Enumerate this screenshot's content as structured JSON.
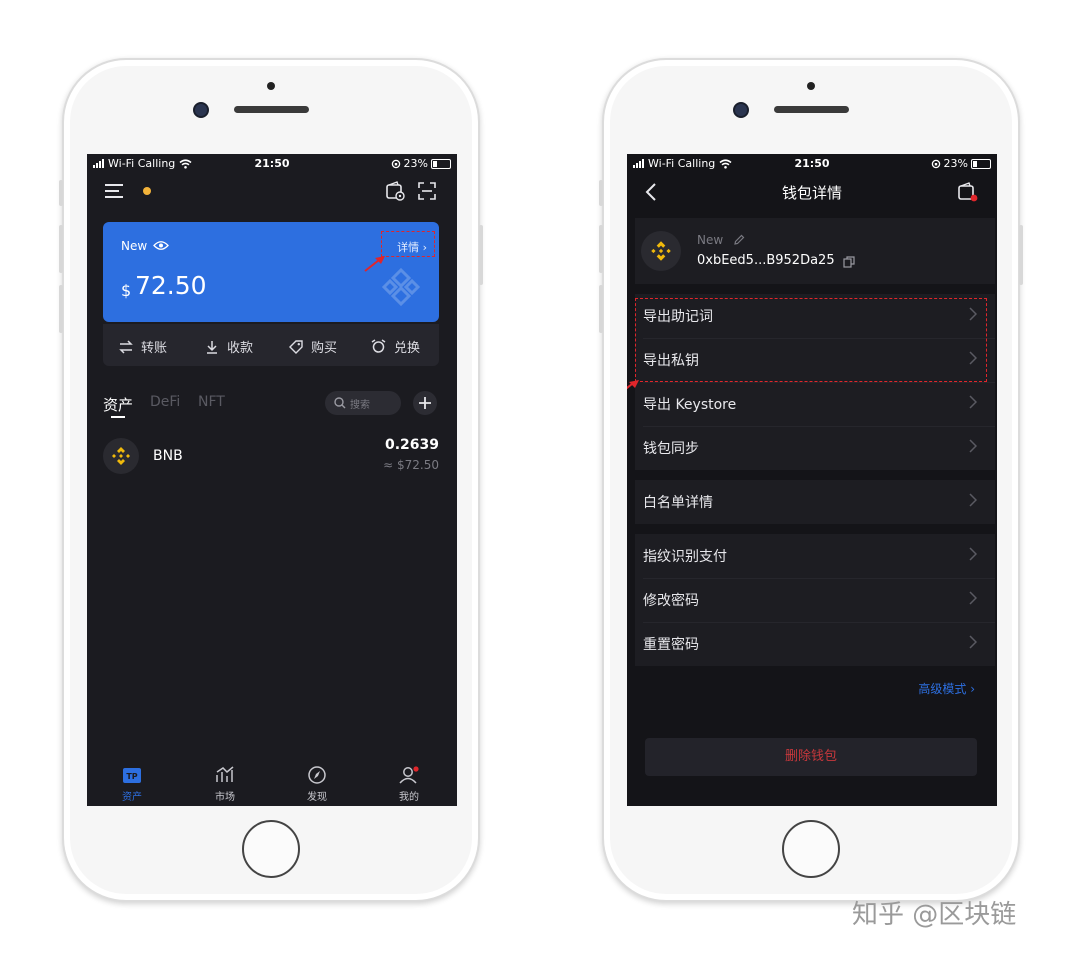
{
  "left": {
    "status": {
      "carrier": "Wi-Fi Calling",
      "time": "21:50",
      "battery": "23%"
    },
    "card": {
      "wallet_name": "New",
      "details_label": "详情",
      "currency_symbol": "$",
      "balance": "72.50",
      "color": "#2d6fe0"
    },
    "actions": [
      {
        "label": "转账",
        "icon": "transfer-icon"
      },
      {
        "label": "收款",
        "icon": "receive-icon"
      },
      {
        "label": "购买",
        "icon": "buy-tag-icon"
      },
      {
        "label": "兑换",
        "icon": "swap-icon"
      }
    ],
    "tabs": [
      {
        "label": "资产",
        "active": true
      },
      {
        "label": "DeFi",
        "active": false
      },
      {
        "label": "NFT",
        "active": false
      }
    ],
    "search_placeholder": "搜索",
    "asset": {
      "symbol": "BNB",
      "amount": "0.2639",
      "value": "≈ $72.50"
    },
    "nav": [
      {
        "label": "资产",
        "active": true
      },
      {
        "label": "市场",
        "active": false
      },
      {
        "label": "发现",
        "active": false
      },
      {
        "label": "我的",
        "active": false
      }
    ]
  },
  "right": {
    "status": {
      "carrier": "Wi-Fi Calling",
      "time": "21:50",
      "battery": "23%"
    },
    "title": "钱包详情",
    "wallet": {
      "name": "New",
      "address": "0xbEed5...B952Da25"
    },
    "menu_group1": [
      "导出助记词",
      "导出私钥",
      "导出 Keystore",
      "钱包同步"
    ],
    "menu_group2": [
      "白名单详情"
    ],
    "menu_group3": [
      "指纹识别支付",
      "修改密码",
      "重置密码"
    ],
    "advanced_label": "高级模式",
    "delete_label": "删除钱包"
  },
  "watermark": "知乎 @区块链",
  "colors": {
    "accent": "#2d6fe0",
    "bnb": "#f0b90b",
    "danger": "#c8383c",
    "highlight": "#e0262b"
  }
}
